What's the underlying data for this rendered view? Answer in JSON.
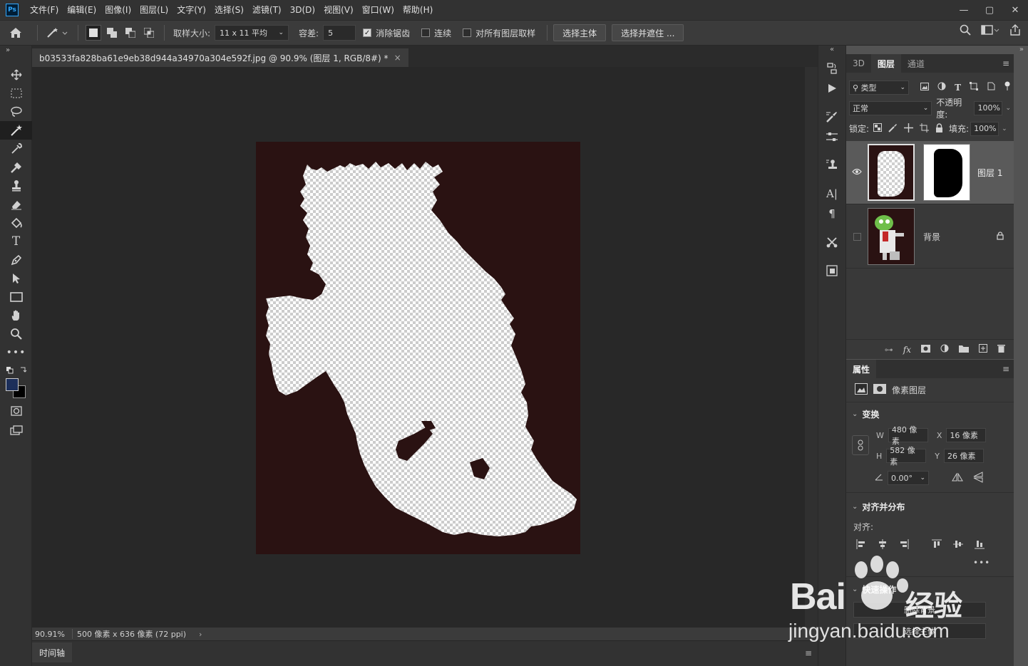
{
  "menu": [
    "文件(F)",
    "编辑(E)",
    "图像(I)",
    "图层(L)",
    "文字(Y)",
    "选择(S)",
    "滤镜(T)",
    "3D(D)",
    "视图(V)",
    "窗口(W)",
    "帮助(H)"
  ],
  "app_logo": "Ps",
  "window_controls": [
    "—",
    "▢",
    "✕"
  ],
  "options": {
    "sample_size_label": "取样大小:",
    "sample_size_value": "11 x 11 平均",
    "tolerance_label": "容差:",
    "tolerance_value": "5",
    "anti_alias_label": "消除锯齿",
    "anti_alias_checked": true,
    "contiguous_label": "连续",
    "contiguous_checked": false,
    "all_layers_label": "对所有图层取样",
    "all_layers_checked": false,
    "select_subject": "选择主体",
    "select_mask": "选择并遮住 ..."
  },
  "document": {
    "tab_title": "b03533fa828ba61e9eb38d944a34970a304e592f.jpg @ 90.9% (图层 1, RGB/8#) *",
    "zoom": "90.91%",
    "dimensions": "500 像素 x 636 像素 (72 ppi)",
    "canvas_bg": "#2a1212"
  },
  "timeline_tab": "时间轴",
  "layers_panel": {
    "tabs": [
      "3D",
      "图层",
      "通道"
    ],
    "active_tab": "图层",
    "filter_kind": "类型",
    "blend_mode": "正常",
    "opacity_label": "不透明度:",
    "opacity_value": "100%",
    "lock_label": "锁定:",
    "fill_label": "填充:",
    "fill_value": "100%",
    "layers": [
      {
        "name": "图层 1",
        "visible": true,
        "selected": true
      },
      {
        "name": "背景",
        "visible": false,
        "selected": false,
        "locked": true
      }
    ]
  },
  "properties_panel": {
    "tab": "属性",
    "type_label": "像素图层",
    "transform_title": "变换",
    "w_label": "W",
    "w_value": "480 像素",
    "h_label": "H",
    "h_value": "582 像素",
    "x_label": "X",
    "x_value": "16 像素",
    "y_label": "Y",
    "y_value": "26 像素",
    "angle_value": "0.00°",
    "align_title": "对齐并分布",
    "align_label": "对齐:",
    "quick_title": "快速操作",
    "quick_btn1": "删除背景",
    "quick_btn2": "选择主体"
  },
  "watermark": {
    "brand": "Bai",
    "brand2": "经验",
    "url": "jingyan.baidu.com"
  }
}
